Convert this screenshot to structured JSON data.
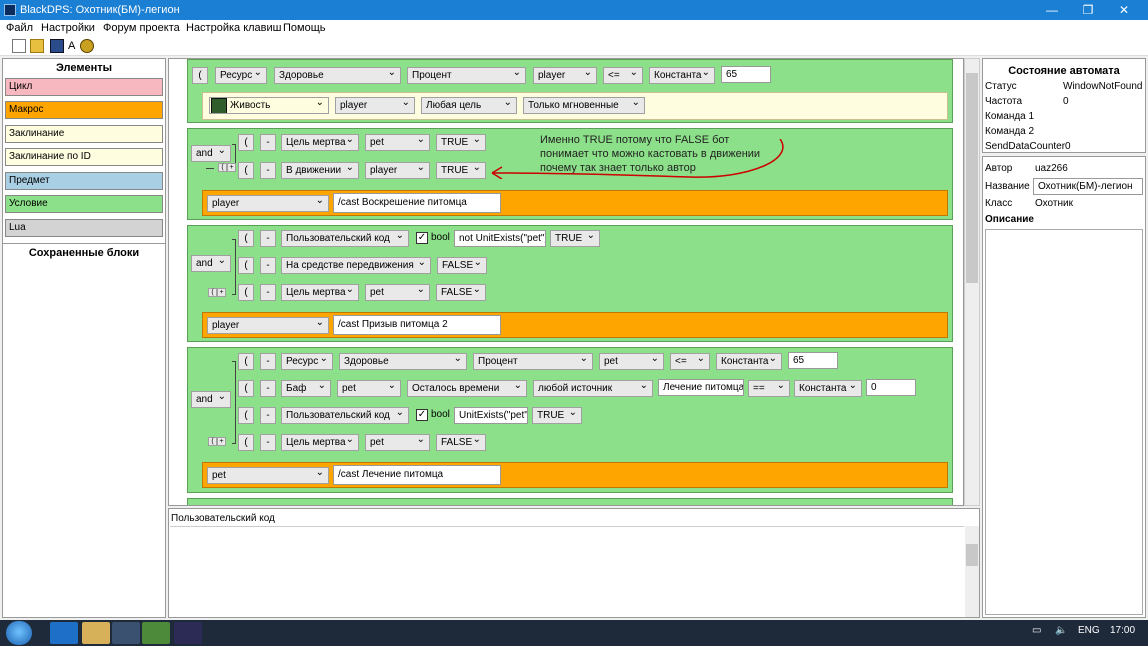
{
  "window": {
    "title": "BlackDPS: Охотник(БМ)-легион"
  },
  "menu": [
    "Файл",
    "Настройки",
    "Форум проекта",
    "Настройка клавиш",
    "Помощь"
  ],
  "toolbar": {
    "a_label": "A"
  },
  "elements": {
    "title": "Элементы",
    "items": [
      {
        "label": "Цикл",
        "color": "#f7b8c0"
      },
      {
        "label": "Макрос",
        "color": "#ffa500"
      },
      {
        "label": "Заклинание",
        "color": "#fffde0"
      },
      {
        "label": "Заклинание по ID",
        "color": "#fffde0"
      },
      {
        "label": "Предмет",
        "color": "#a9cfe5"
      },
      {
        "label": "Условие",
        "color": "#8de08a"
      },
      {
        "label": "Lua",
        "color": "#d3d3d3"
      }
    ],
    "saved_title": "Сохраненные блоки"
  },
  "block0": {
    "bracket": "(",
    "resource": "Ресурс",
    "health": "Здоровье",
    "percent": "Процент",
    "unit": "player",
    "op": "<=",
    "const": "Константа",
    "value": "65",
    "spell": "Живость",
    "spell_unit": "player",
    "target": "Любая цель",
    "instant": "Только мгновенные"
  },
  "block1": {
    "logic": "and",
    "bracket": "(",
    "minus": "-",
    "plus": "+",
    "rows": [
      {
        "cond": "Цель мертва",
        "unit": "pet",
        "val": "TRUE"
      },
      {
        "cond": "В движении",
        "unit": "player",
        "val": "TRUE"
      }
    ],
    "macro_unit": "player",
    "macro_text": "/cast Воскрешение питомца",
    "annotation": [
      "Именно TRUE потому что FALSE бот",
      "понимает что можно кастовать в движении",
      "почему так знает только автор"
    ]
  },
  "block2": {
    "logic": "and",
    "bracket": "(",
    "minus": "-",
    "r1": {
      "cond": "Пользовательский код",
      "bool": "bool",
      "code": "not UnitExists(\"pet\")",
      "val": "TRUE"
    },
    "r2": {
      "cond": "На средстве передвижения",
      "val": "FALSE"
    },
    "r3": {
      "cond": "Цель мертва",
      "unit": "pet",
      "val": "FALSE"
    },
    "macro_unit": "player",
    "macro_text": "/cast Призыв питомца 2"
  },
  "block3": {
    "logic": "and",
    "bracket": "(",
    "minus": "-",
    "r1": {
      "res": "Ресурс",
      "health": "Здоровье",
      "percent": "Процент",
      "unit": "pet",
      "op": "<=",
      "const": "Константа",
      "value": "65"
    },
    "r2": {
      "buff": "Баф",
      "unit": "pet",
      "time": "Осталось времени",
      "source": "любой источник",
      "name": "Лечение питомца",
      "op": "==",
      "const": "Константа",
      "value": "0"
    },
    "r3": {
      "cond": "Пользовательский код",
      "bool": "bool",
      "code": "UnitExists(\"pet\")",
      "val": "TRUE"
    },
    "r4": {
      "cond": "Цель мертва",
      "unit": "pet",
      "val": "FALSE"
    },
    "macro_unit": "pet",
    "macro_text": "/cast Лечение питомца"
  },
  "code_panel": {
    "title": "Пользовательский код"
  },
  "state": {
    "title": "Состояние автомата",
    "rows": [
      {
        "k": "Статус",
        "v": "WindowNotFound"
      },
      {
        "k": "Частота",
        "v": "0"
      },
      {
        "k": "Команда 1",
        "v": ""
      },
      {
        "k": "Команда 2",
        "v": ""
      },
      {
        "k": "SendDataCounter",
        "v": "0"
      }
    ]
  },
  "info": {
    "author_label": "Автор",
    "author": "uaz266",
    "name_label": "Название",
    "name": "Охотник(БМ)-легион",
    "class_label": "Класс",
    "class": "Охотник",
    "desc_label": "Описание"
  },
  "tray": {
    "lang": "ENG",
    "time": "17:00"
  }
}
